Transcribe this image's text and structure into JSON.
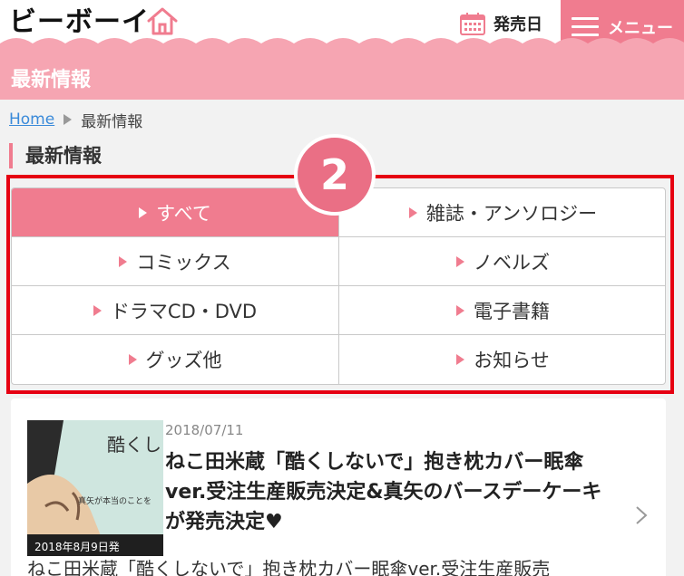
{
  "header": {
    "logo_text": "ビーボーイ",
    "release_label": "発売日",
    "menu_label": "メニュー",
    "icons": [
      "home-icon",
      "calendar-icon",
      "hamburger-menu-icon"
    ]
  },
  "page_title": "最新情報",
  "breadcrumb": {
    "home": "Home",
    "current": "最新情報"
  },
  "section_title": "最新情報",
  "badge_number": "2",
  "categories": [
    {
      "label": "すべて",
      "active": true
    },
    {
      "label": "雑誌・アンソロジー",
      "active": false
    },
    {
      "label": "コミックス",
      "active": false
    },
    {
      "label": "ノベルズ",
      "active": false
    },
    {
      "label": "ドラマCD・DVD",
      "active": false
    },
    {
      "label": "電子書籍",
      "active": false
    },
    {
      "label": "グッズ他",
      "active": false
    },
    {
      "label": "お知らせ",
      "active": false
    }
  ],
  "news": {
    "date": "2018/07/11",
    "title": "ねこ田米蔵「酷くしないで」抱き枕カバー眠傘ver.受注生産販売決定&真矢のバースデーケーキが発売決定♥",
    "summary": "ねこ田米蔵「酷くしないで」抱き枕カバー眠傘ver.受注生産販売",
    "thumb_text_top": "酷くし",
    "thumb_text_side": "真矢が本当のことを",
    "thumb_date": "2018年8月9日発"
  },
  "colors": {
    "accent": "#f07c8f",
    "title_bar": "#f6a5b2",
    "highlight_border": "#e60012",
    "badge": "#ea6f85",
    "link": "#3a8ad9"
  }
}
